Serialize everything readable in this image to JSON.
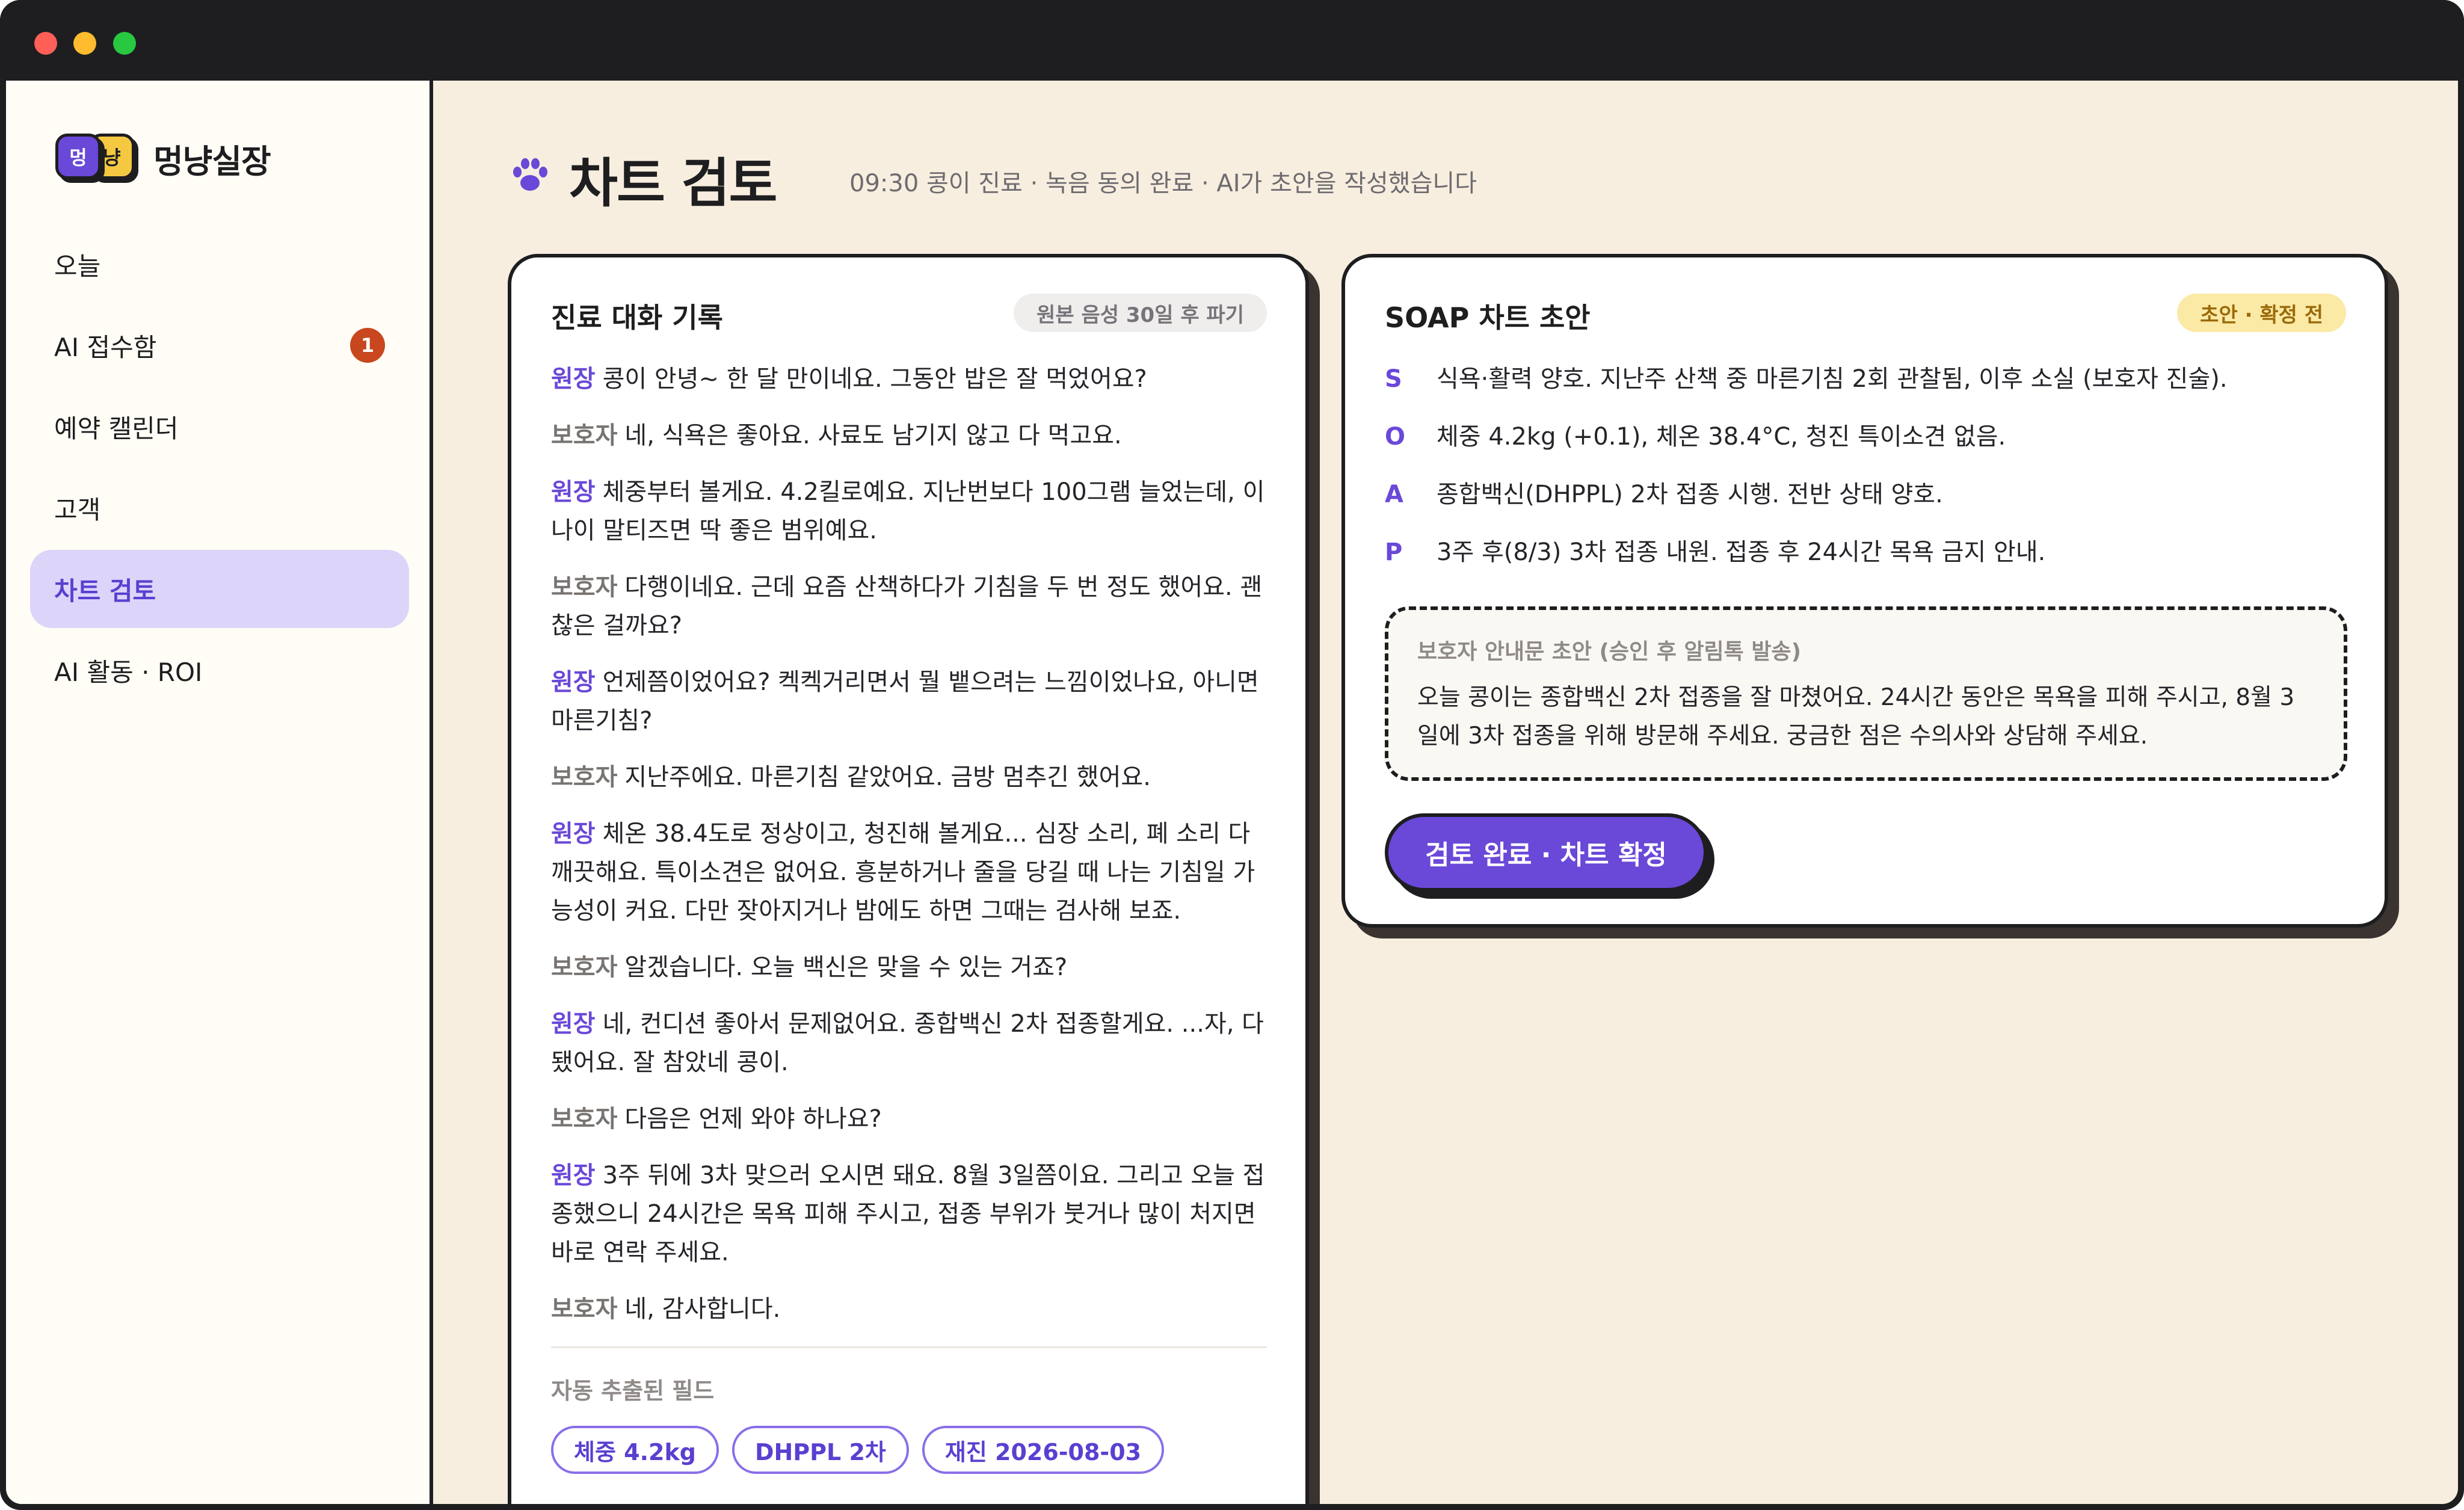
{
  "app": {
    "logo_badge_1": "멍",
    "logo_badge_2": "냥",
    "name": "멍냥실장"
  },
  "sidebar": {
    "items": [
      {
        "label": "오늘"
      },
      {
        "label": "AI 접수함",
        "badge": "1"
      },
      {
        "label": "예약 캘린더"
      },
      {
        "label": "고객"
      },
      {
        "label": "차트 검토"
      },
      {
        "label": "AI 활동 · ROI"
      }
    ]
  },
  "page": {
    "title": "차트 검토",
    "subtitle": "09:30 콩이 진료 · 녹음 동의 완료 · AI가 초안을 작성했습니다"
  },
  "transcript": {
    "title": "진료 대화 기록",
    "retention_pill": "원본 음성 30일 후 파기",
    "lines": [
      {
        "speaker": "원장",
        "text": "콩이 안녕~ 한 달 만이네요. 그동안 밥은 잘 먹었어요?"
      },
      {
        "speaker": "보호자",
        "text": "네, 식욕은 좋아요. 사료도 남기지 않고 다 먹고요."
      },
      {
        "speaker": "원장",
        "text": "체중부터 볼게요. 4.2킬로예요. 지난번보다 100그램 늘었는데, 이 나이 말티즈면 딱 좋은 범위예요."
      },
      {
        "speaker": "보호자",
        "text": "다행이네요. 근데 요즘 산책하다가 기침을 두 번 정도 했어요. 괜찮은 걸까요?"
      },
      {
        "speaker": "원장",
        "text": "언제쯤이었어요? 켁켁거리면서 뭘 뱉으려는 느낌이었나요, 아니면 마른기침?"
      },
      {
        "speaker": "보호자",
        "text": "지난주에요. 마른기침 같았어요. 금방 멈추긴 했어요."
      },
      {
        "speaker": "원장",
        "text": "체온 38.4도로 정상이고, 청진해 볼게요... 심장 소리, 폐 소리 다 깨끗해요. 특이소견은 없어요. 흥분하거나 줄을 당길 때 나는 기침일 가능성이 커요. 다만 잦아지거나 밤에도 하면 그때는 검사해 보죠."
      },
      {
        "speaker": "보호자",
        "text": "알겠습니다. 오늘 백신은 맞을 수 있는 거죠?"
      },
      {
        "speaker": "원장",
        "text": "네, 컨디션 좋아서 문제없어요. 종합백신 2차 접종할게요. ...자, 다 됐어요. 잘 참았네 콩이."
      },
      {
        "speaker": "보호자",
        "text": "다음은 언제 와야 하나요?"
      },
      {
        "speaker": "원장",
        "text": "3주 뒤에 3차 맞으러 오시면 돼요. 8월 3일쯤이요. 그리고 오늘 접종했으니 24시간은 목욕 피해 주시고, 접종 부위가 붓거나 많이 처지면 바로 연락 주세요."
      },
      {
        "speaker": "보호자",
        "text": "네, 감사합니다."
      }
    ],
    "extracted_label": "자동 추출된 필드",
    "tags": [
      "체중 4.2kg",
      "DHPPL 2차",
      "재진 2026-08-03"
    ]
  },
  "soap": {
    "title": "SOAP 차트 초안",
    "status_pill": "초안 · 확정 전",
    "rows": [
      {
        "letter": "S",
        "text": "식욕·활력 양호. 지난주 산책 중 마른기침 2회 관찰됨, 이후 소실 (보호자 진술)."
      },
      {
        "letter": "O",
        "text": "체중 4.2kg (+0.1), 체온 38.4°C, 청진 특이소견 없음."
      },
      {
        "letter": "A",
        "text": "종합백신(DHPPL) 2차 접종 시행. 전반 상태 양호."
      },
      {
        "letter": "P",
        "text": "3주 후(8/3) 3차 접종 내원. 접종 후 24시간 목욕 금지 안내."
      }
    ],
    "guardian_label": "보호자 안내문 초안 (승인 후 알림톡 발송)",
    "guardian_text": "오늘 콩이는 종합백신 2차 접종을 잘 마쳤어요. 24시간 동안은 목욕을 피해 주시고, 8월 3일에 3차 접종을 위해 방문해 주세요. 궁금한 점은 수의사와 상담해 주세요.",
    "confirm_button": "검토 완료 · 차트 확정"
  },
  "colors": {
    "accent": "#6a48d8",
    "background": "#f7eedf",
    "badge": "#c8471e"
  }
}
